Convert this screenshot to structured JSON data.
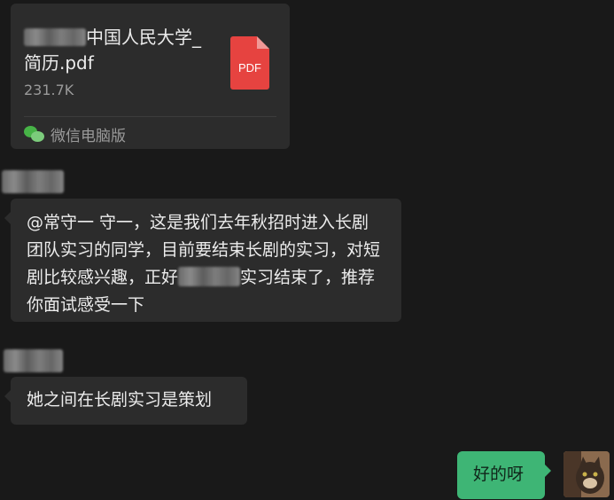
{
  "file_message": {
    "name_suffix": "中国人民大学_简历.pdf",
    "size": "231.7K",
    "file_type_label": "PDF",
    "source": "微信电脑版",
    "icon": "pdf-file-icon",
    "source_icon": "wechat-logo-icon"
  },
  "messages": [
    {
      "part1": "@常守一 守一，这是我们去年秋招时进入长剧团队实习的同学，目前要结束长剧的实习，对短剧比较感兴趣，正好",
      "part2": "实习结束了，推荐你面试感受一下"
    },
    {
      "text": "她之间在长剧实习是策划"
    }
  ],
  "own_message": {
    "text": "好的呀"
  },
  "colors": {
    "background": "#191919",
    "incoming_bubble": "#2c2c2c",
    "outgoing_bubble": "#3eb575",
    "pdf_red": "#e64340"
  }
}
